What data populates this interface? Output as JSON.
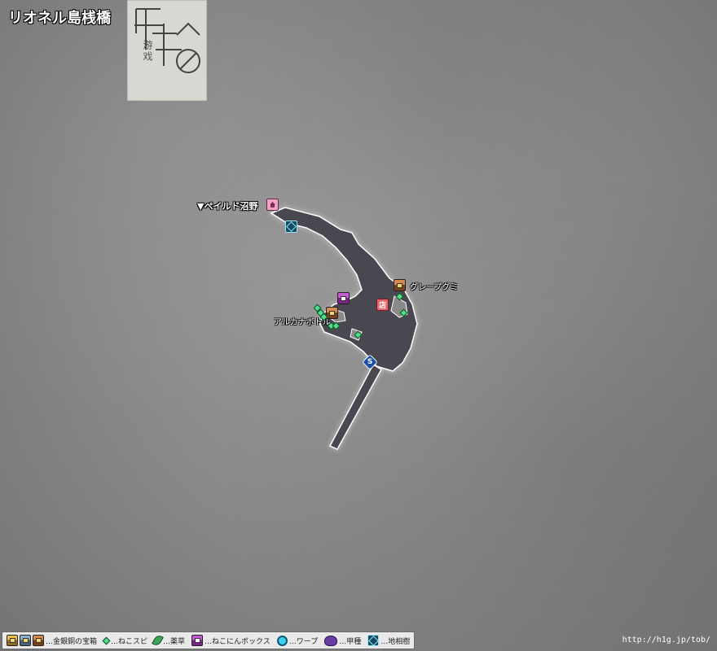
{
  "title": "リオネル島桟橋",
  "watermark": {
    "text": "游戏"
  },
  "labels": {
    "exit": "▼ペイルド沼野",
    "grape": "グレープグミ",
    "arcana": "アルカナボトル",
    "shop": "店",
    "save": "S"
  },
  "icons": {
    "exit_home": "house-icon",
    "shop": "shop-icon",
    "tree": "earth-tree-icon",
    "save": "save-point-icon",
    "chest": "treasure-chest-icon",
    "nekobox": "nekonin-box-icon"
  },
  "legend": {
    "chest": "…金銀銅の宝箱",
    "neko": "…ねこスピ",
    "herb": "…薬草",
    "nekobox": "…ねこにんボックス",
    "warp": "…ワープ",
    "beetle": "…甲種",
    "tree": "…地相樹"
  },
  "footer_url": "http://h1g.jp/tob/",
  "colors": {
    "walkable": "#4a4750",
    "outline": "#ffffff",
    "gem": "#4fe08a"
  }
}
